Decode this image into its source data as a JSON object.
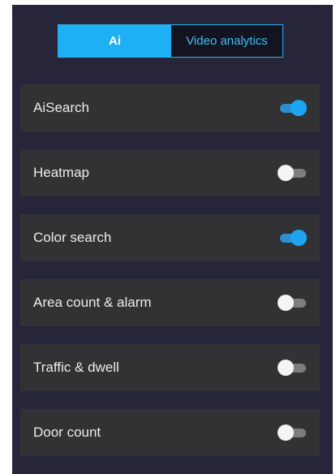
{
  "tabs": [
    {
      "label": "Ai",
      "active": true
    },
    {
      "label": "Video analytics",
      "active": false
    }
  ],
  "features": [
    {
      "label": "AiSearch",
      "enabled": true
    },
    {
      "label": "Heatmap",
      "enabled": false
    },
    {
      "label": "Color search",
      "enabled": true
    },
    {
      "label": "Area count & alarm",
      "enabled": false
    },
    {
      "label": "Traffic & dwell",
      "enabled": false
    },
    {
      "label": "Door count",
      "enabled": false
    }
  ],
  "colors": {
    "accent": "#1eb0f5",
    "toggle_on": "#1ea5f2",
    "panel_bg": "#26253a",
    "row_bg": "#323234"
  }
}
